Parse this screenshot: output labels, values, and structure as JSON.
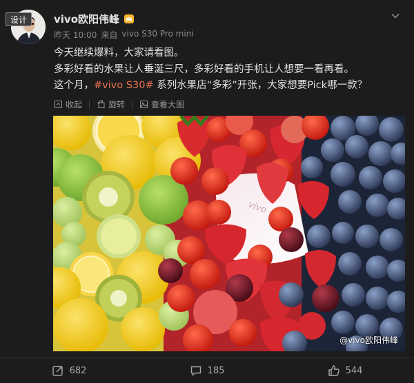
{
  "author": {
    "name": "vivo欧阳伟峰",
    "tag": "设计",
    "badge_icon": "vip-crown-icon"
  },
  "meta": {
    "time": "昨天 10:00",
    "source_prefix": "来自",
    "source": "vivo S30 Pro mini"
  },
  "content": {
    "line1": "今天继续爆料，大家请看图。",
    "line2": "多彩好看的水果让人垂涎三尺，多彩好看的手机让人想要一看再看。",
    "line3_prefix": "这个月，",
    "hashtag": "#vivo S30#",
    "line3_suffix": " 系列水果店“多彩”开张，大家想要Pick哪一款？"
  },
  "toolbar": {
    "collect": "收起",
    "rotate": "旋转",
    "view_large": "查看大图"
  },
  "image": {
    "watermark": "@vivo欧阳伟峰",
    "logo_text": "vivo"
  },
  "actions": {
    "repost": "682",
    "comment": "185",
    "like": "544"
  },
  "colors": {
    "background": "#1c1c1c",
    "hashtag": "#eb7350",
    "text": "#e0e0e0",
    "muted": "#8a8a8a"
  }
}
